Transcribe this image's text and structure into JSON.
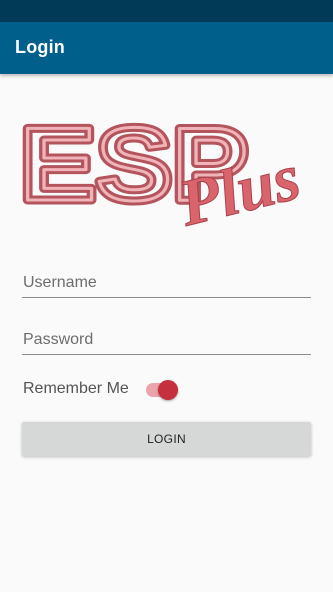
{
  "app_bar": {
    "title": "Login"
  },
  "logo": {
    "main": "ESP",
    "sub": "Plus"
  },
  "form": {
    "username_placeholder": "Username",
    "username_value": "",
    "password_placeholder": "Password",
    "password_value": "",
    "remember_label": "Remember Me",
    "remember_checked": true,
    "login_label": "LOGIN"
  },
  "colors": {
    "status_bar": "#003a57",
    "app_bar": "#005f8b",
    "accent": "#c62f3e",
    "button_bg": "#d6d7d7"
  }
}
